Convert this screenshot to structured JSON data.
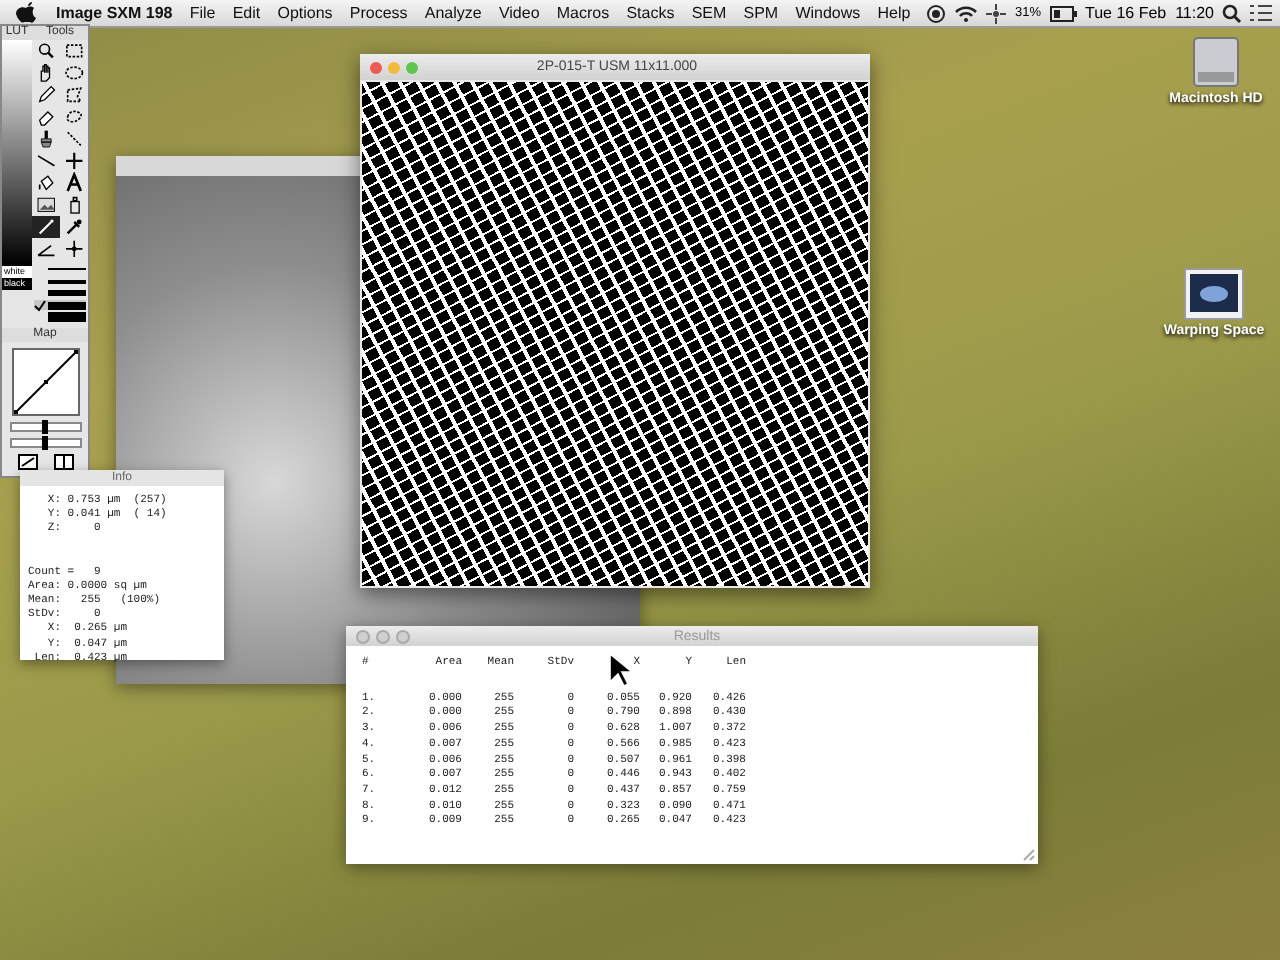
{
  "menu_bar": {
    "app": "Image SXM 198",
    "menus": [
      "File",
      "Edit",
      "Options",
      "Process",
      "Analyze",
      "Video",
      "Macros",
      "Stacks",
      "SEM",
      "SPM",
      "Windows",
      "Help"
    ],
    "battery": "31%",
    "clock": "Tue 16 Feb  11:20"
  },
  "palette": {
    "lut_title": "LUT",
    "tools_title": "Tools",
    "lut_labels": [
      "white",
      "black"
    ],
    "tools": [
      {
        "kind": "magnifier",
        "selected": false
      },
      {
        "kind": "rect",
        "selected": false
      },
      {
        "kind": "hand",
        "selected": false
      },
      {
        "kind": "oval",
        "selected": false
      },
      {
        "kind": "pencil",
        "selected": false
      },
      {
        "kind": "polygon",
        "selected": false
      },
      {
        "kind": "eraser",
        "selected": false
      },
      {
        "kind": "freehand",
        "selected": false
      },
      {
        "kind": "brush",
        "selected": false
      },
      {
        "kind": "segment",
        "selected": false
      },
      {
        "kind": "line",
        "selected": false
      },
      {
        "kind": "cross",
        "selected": false
      },
      {
        "kind": "bucket",
        "selected": false
      },
      {
        "kind": "text",
        "selected": false
      },
      {
        "kind": "picture",
        "selected": false
      },
      {
        "kind": "spray",
        "selected": false
      },
      {
        "kind": "wand",
        "selected": true
      },
      {
        "kind": "dropper",
        "selected": false
      },
      {
        "kind": "angle",
        "selected": false
      },
      {
        "kind": "point",
        "selected": false
      }
    ],
    "line_widths": [
      {
        "selected": false
      },
      {
        "selected": false
      },
      {
        "selected": false
      },
      {
        "selected": true
      },
      {
        "selected": false
      }
    ],
    "map_title": "Map",
    "sliders": [
      {
        "level": 0.5
      },
      {
        "level": 0.5
      }
    ]
  },
  "image_window": {
    "title": "2P-015-T USM 11x11.000"
  },
  "info": {
    "title": "Info",
    "cursor": [
      "   X: 0.753 µm  (257)",
      "   Y: 0.041 µm  ( 14)",
      "   Z:     0"
    ],
    "measure": [
      "Count =   9",
      "Area: 0.0000 sq µm",
      "Mean:   255   (100%)",
      "StDv:     0",
      "   X:  0.265 µm",
      "   Y:  0.047 µm",
      " Len:  0.423 µm"
    ]
  },
  "results": {
    "title": "Results",
    "columns": [
      "#",
      "Area",
      "Mean",
      "StDv",
      "X",
      "Y",
      "Len"
    ],
    "rows": [
      [
        "1.",
        "0.000",
        "255",
        "0",
        "0.055",
        "0.920",
        "0.426"
      ],
      [
        "2.",
        "0.000",
        "255",
        "0",
        "0.790",
        "0.898",
        "0.430"
      ],
      [
        "3.",
        "0.006",
        "255",
        "0",
        "0.628",
        "1.007",
        "0.372"
      ],
      [
        "4.",
        "0.007",
        "255",
        "0",
        "0.566",
        "0.985",
        "0.423"
      ],
      [
        "5.",
        "0.006",
        "255",
        "0",
        "0.507",
        "0.961",
        "0.398"
      ],
      [
        "6.",
        "0.007",
        "255",
        "0",
        "0.446",
        "0.943",
        "0.402"
      ],
      [
        "7.",
        "0.012",
        "255",
        "0",
        "0.437",
        "0.857",
        "0.759"
      ],
      [
        "8.",
        "0.010",
        "255",
        "0",
        "0.323",
        "0.090",
        "0.471"
      ],
      [
        "9.",
        "0.009",
        "255",
        "0",
        "0.265",
        "0.047",
        "0.423"
      ]
    ]
  },
  "desktop_icons": [
    {
      "label": "Macintosh HD",
      "kind": "drive"
    },
    {
      "label": "Warping Space",
      "kind": "picture"
    }
  ]
}
